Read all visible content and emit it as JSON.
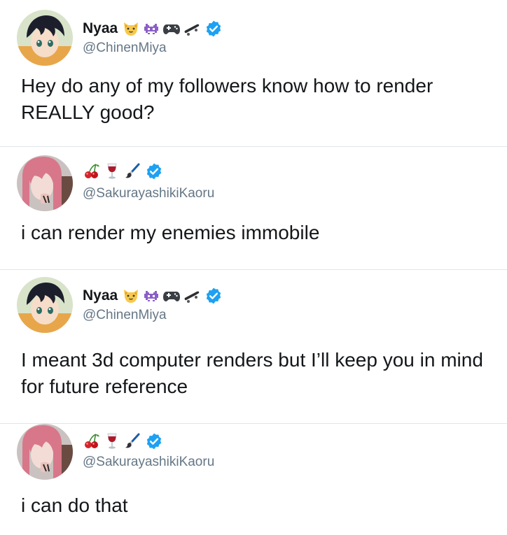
{
  "tweets": [
    {
      "name": "Nyaa",
      "handle": "@ChinenMiya",
      "text": "Hey do any of my followers know how to render REALLY good?",
      "emojis": [
        "cat-face-emoji",
        "alien-monster-emoji",
        "game-controller-emoji",
        "skateboard-emoji"
      ],
      "verified": true
    },
    {
      "name": "",
      "handle": "@SakurayashikiKaoru",
      "text": "i can render my enemies immobile",
      "emojis": [
        "cherries-emoji",
        "wine-glass-emoji",
        "paintbrush-emoji"
      ],
      "verified": true
    },
    {
      "name": "Nyaa",
      "handle": "@ChinenMiya",
      "text": "I meant 3d computer renders but I’ll keep you in mind for future reference",
      "emojis": [
        "cat-face-emoji",
        "alien-monster-emoji",
        "game-controller-emoji",
        "skateboard-emoji"
      ],
      "verified": true
    },
    {
      "name": "",
      "handle": "@SakurayashikiKaoru",
      "text": "i can do that",
      "emojis": [
        "cherries-emoji",
        "wine-glass-emoji",
        "paintbrush-emoji"
      ],
      "verified": true
    }
  ],
  "colors": {
    "text": "#14171a",
    "handle": "#657786",
    "verified": "#1da1f2",
    "divider": "#e1e6ea"
  }
}
